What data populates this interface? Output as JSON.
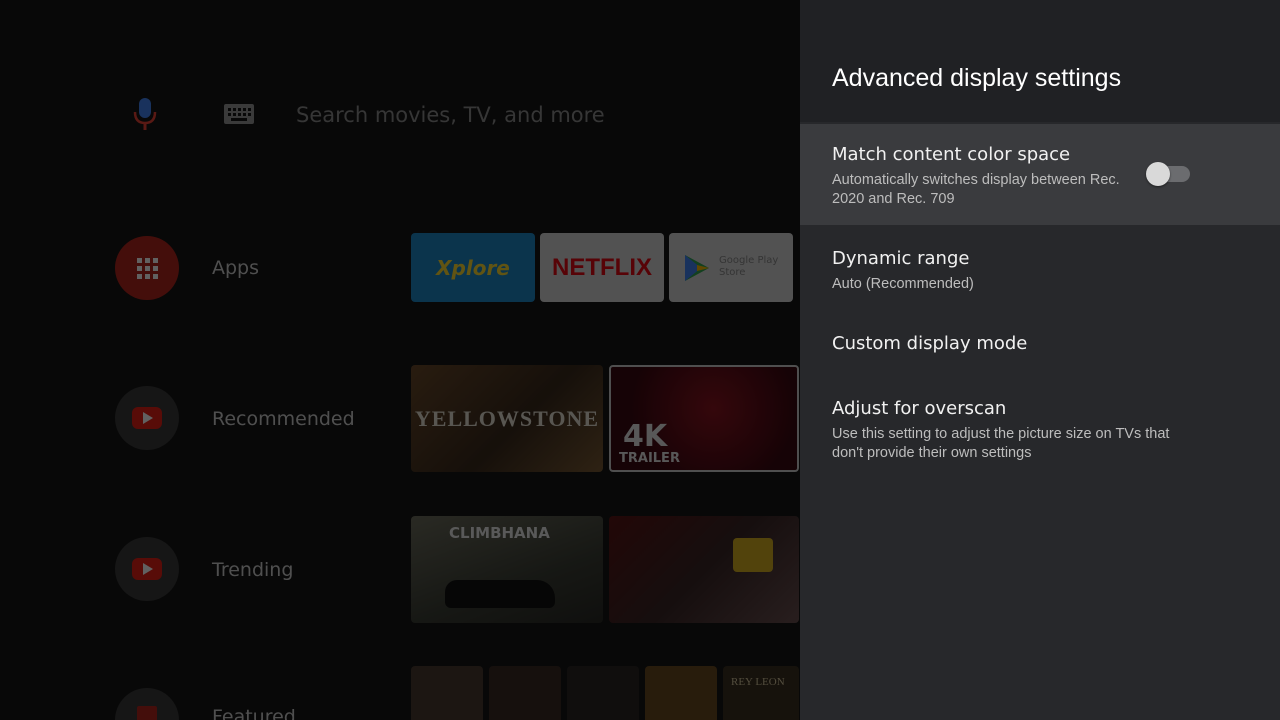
{
  "home": {
    "search": {
      "placeholder": "Search movies, TV, and more"
    },
    "rows": [
      {
        "label": "Apps",
        "icon": "apps-grid-icon"
      },
      {
        "label": "Recommended",
        "icon": "youtube-icon"
      },
      {
        "label": "Trending",
        "icon": "youtube-icon"
      },
      {
        "label": "Featured",
        "icon": "featured-icon"
      }
    ],
    "app_tiles": {
      "xplore": "Xplore",
      "netflix": "NETFLIX",
      "play_store": "Google Play Store"
    },
    "video_tiles": {
      "yellowstone": "YELLOWSTONE",
      "trailer_4k": "4K",
      "trailer_text": "TRAILER",
      "climbhana": "CLIMBHANA",
      "rey_leon": "REY LEON"
    }
  },
  "panel": {
    "title": "Advanced display settings",
    "items": [
      {
        "title": "Match content color space",
        "subtitle": "Automatically switches display between Rec. 2020 and Rec. 709",
        "toggle_on": false
      },
      {
        "title": "Dynamic range",
        "subtitle": "Auto (Recommended)"
      },
      {
        "title": "Custom display mode"
      },
      {
        "title": "Adjust for overscan",
        "subtitle": "Use this setting to adjust the picture size on TVs that don't provide their own settings"
      }
    ]
  },
  "colors": {
    "panel_bg": "#27282b",
    "panel_header_bg": "#202124",
    "focus_bg": "#3a3b3e",
    "youtube_red": "#e62117",
    "netflix_red": "#e50914"
  }
}
